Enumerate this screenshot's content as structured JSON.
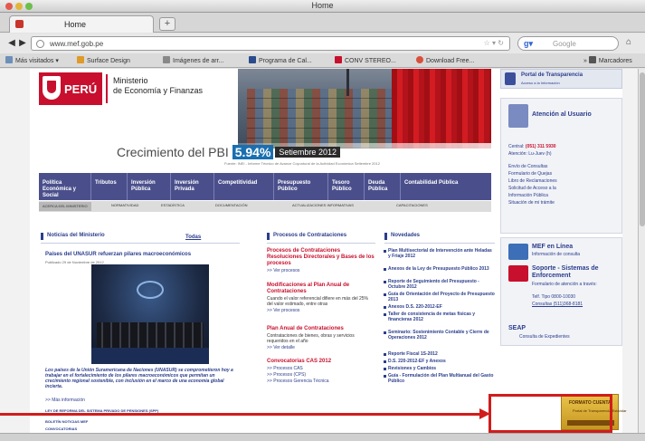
{
  "browser": {
    "window_title": "Home",
    "tab_label": "Home",
    "url": "www.mef.gob.pe",
    "search_placeholder": "Google",
    "bookmarks": [
      "Más visitados",
      "Surface Design",
      "Imágenes de arr...",
      "Programa de Cal...",
      "CONV STEREO...",
      "Download Free...",
      "Marcadores"
    ]
  },
  "header": {
    "logo_text": "PERÚ",
    "ministry_line1": "Ministerio",
    "ministry_line2": "de Economía y Finanzas",
    "hero_title": "Crecimiento del PBI",
    "hero_value": "5.94%",
    "hero_period": "Setiembre 2012",
    "hero_caption": "Fuente: INEI - Informe Técnico de Avance Coyuntural de la Actividad Económica Setiembre 2012"
  },
  "main_menu": [
    "Política Económica y Social",
    "Tributos",
    "Inversión Pública",
    "Inversión Privada",
    "Competitividad",
    "Presupuesto Público",
    "Tesoro Público",
    "Deuda Pública",
    "Contabilidad Pública"
  ],
  "sub_menu": [
    "ACERCA DEL MINISTERIO",
    "NORMATIVIDAD",
    "ESTADÍSTICA",
    "DOCUMENTACIÓN",
    "ACTUALIZACIONES INFORMATIVAS",
    "CAPACITACIONES"
  ],
  "news": {
    "section_title": "Noticias del Ministerio",
    "all_link": "Todas",
    "headline": "Países del UNASUR refuerzan pilares macroeconómicos",
    "date": "Publicado 29 de Noviembre de 2012",
    "body": "Los países de la Unión Suramericana de Naciones (UNASUR) se comprometieron hoy a trabajar en el fortalecimiento de los pilares macroeconómicos que permitan un crecimiento regional sostenible, con inclusión en el marco de una economía global incierta.",
    "more": ">> Más información",
    "footer_1": "LEY DE REFORMA DEL SISTEMA PRIVADO DE PENSIONES (SPP)",
    "footer_2": "BOLETÍN NOTICIAS MEF",
    "footer_3": "CONVOCATORIAS"
  },
  "procesos": {
    "section_title": "Procesos de Contrataciones",
    "blocks": [
      {
        "title": "Procesos de Contrataciones Resoluciones Directorales y Bases de los procesos",
        "text": "",
        "more": ">> Ver procesos"
      },
      {
        "title": "Modificaciones al Plan Anual de Contrataciones",
        "text": "Cuando el valor referencial difiere en más del 25% del valor estimado, entre otras",
        "more": ">> Ver procesos"
      },
      {
        "title": "Plan Anual de Contrataciones",
        "text": "Contrataciones de bienes, obras y servicios requeridos en el año",
        "more": ">> Ver detalle"
      },
      {
        "title": "Convocatorias CAS 2012",
        "text": "",
        "more": ">> Procesos CAS"
      },
      {
        "title": "",
        "text": "",
        "more": ">> Procesos (CPS)"
      },
      {
        "title": "",
        "text": "",
        "more": ">> Procesos Gerencia Técnica"
      }
    ]
  },
  "novedades": {
    "section_title": "Novedades",
    "items": [
      "Plan Multisectorial de Intervención ante Heladas y Friaje 2012",
      "Anexos de la Ley de Presupuesto Público 2013",
      "Reporte de Seguimiento del Presupuesto - Octubre 2012",
      "Guía de Orientación del Proyecto de Presupuesto 2013",
      "Anexos D.S. 220-2012-EF",
      "Taller de consistencia de metas físicas y financieras 2012",
      "Seminario: Sostenimiento Contable y Cierre de Operaciones 2012",
      "Reporte Fiscal 1S-2012",
      "D.S. 220-2012-EF y Anexos",
      "Revisiones y Cambios",
      "Guía - Formulación del Plan Multianual del Gasto Público"
    ]
  },
  "sidebar": {
    "portal_title": "Portal de Transparencia",
    "portal_sub": "Acceso a la Información",
    "atencion_title": "Atención al Usuario",
    "central_label": "Central:",
    "central_phone": "(051) 311 5930",
    "schedule": "Atención: Lu-Juev (h)",
    "links": [
      "Envío de Consultas",
      "Formulario de Quejas",
      "Libro de Reclamaciones",
      "Solicitud de Acceso a la",
      "Información Pública",
      "Situación de mi trámite"
    ],
    "mef_linea_title": "MEF en Línea",
    "mef_linea_sub": "Información de consulta",
    "soporte_title": "Soporte - Sistemas de Enforcement",
    "soporte_sub": "Formulario de atención a través:",
    "telf": "Telf. Tipo 0800-10030",
    "telf2": "Consultas (511)368-8181",
    "seap_title": "SEAP",
    "seap_sub": "Consulta de Expedientes",
    "highlight_top": "FORMATO CUENTA",
    "highlight_mid": "Portal de Transparencia Estándar"
  },
  "colors": {
    "brand_red": "#c8102e",
    "brand_blue": "#2b3d8c",
    "menu_bg": "#4a4f8c",
    "annotation_red": "#d11c1c"
  }
}
